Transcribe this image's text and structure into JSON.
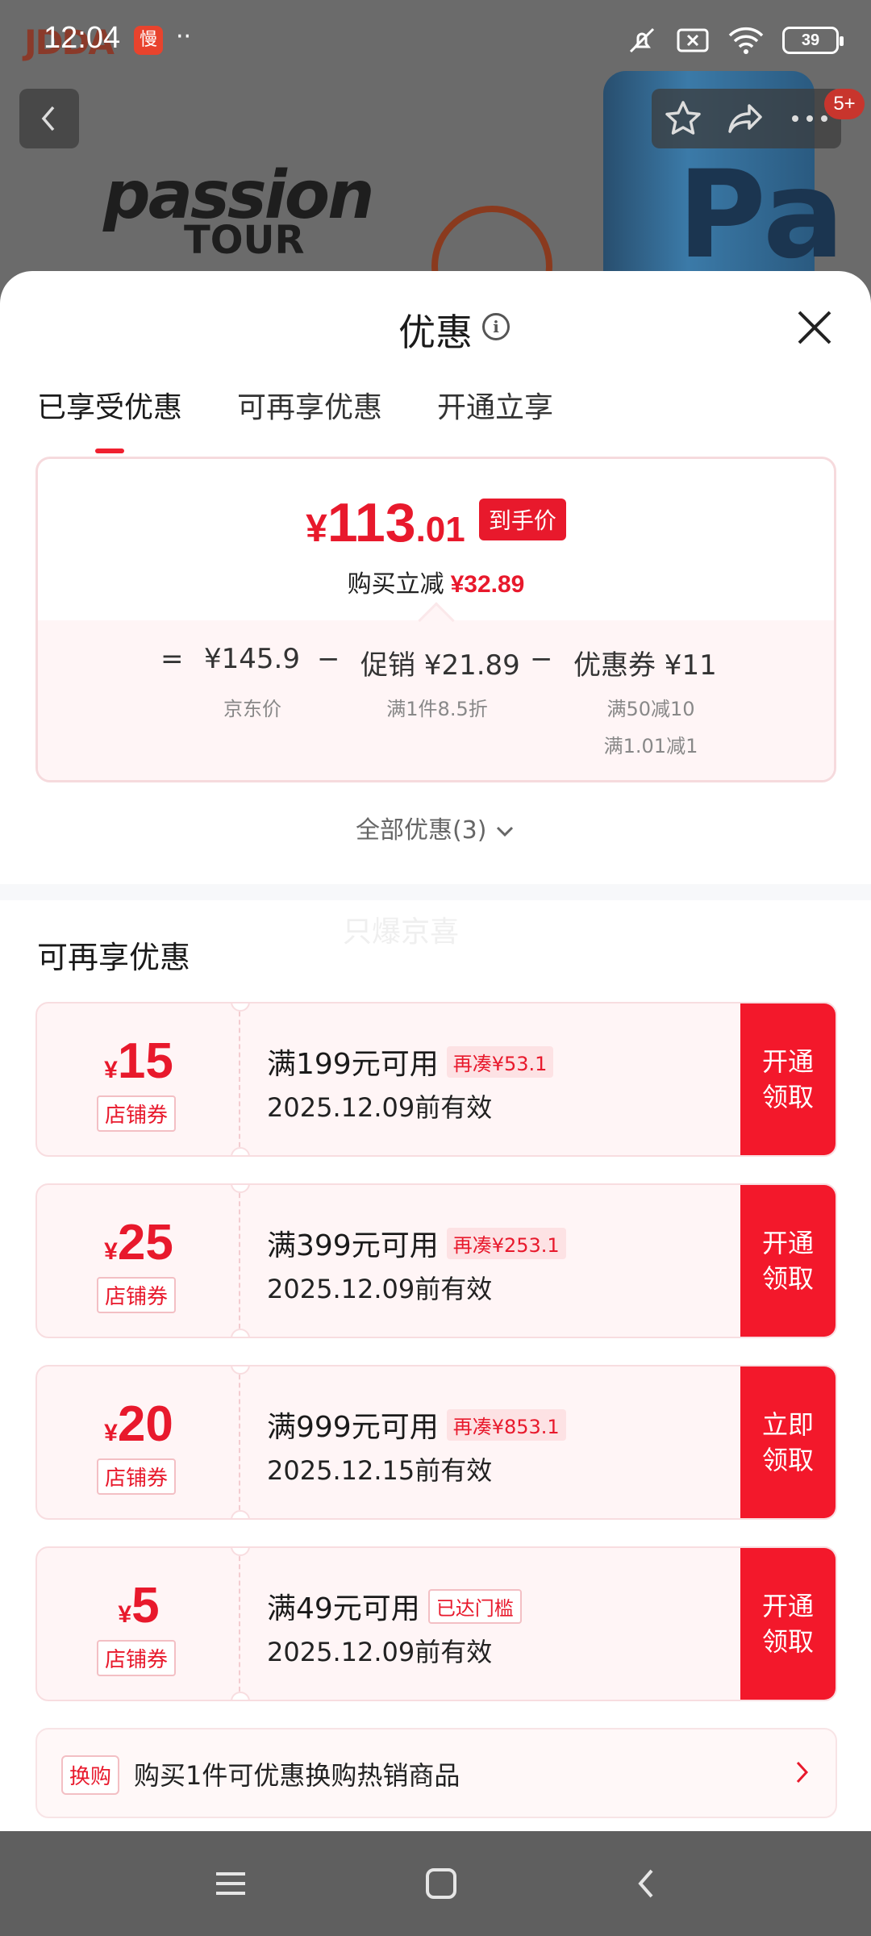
{
  "status_bar": {
    "time": "12:04",
    "app_badge": "慢",
    "dots": "··",
    "battery": "39"
  },
  "background": {
    "brand_logo": "JDDA",
    "product_line1": "passion",
    "product_line2": "TOUR",
    "can_text": "Pa",
    "message_badge": "5+"
  },
  "sheet": {
    "title": "优惠",
    "tabs": [
      {
        "label": "已享受优惠"
      },
      {
        "label": "可再享优惠"
      },
      {
        "label": "开通立享"
      }
    ],
    "summary": {
      "yen": "¥",
      "amount": "113",
      "decimal": ".01",
      "final_tag": "到手价",
      "saving_label": "购买立减",
      "saving_value": "¥32.89",
      "equals": "=",
      "base_price": "¥145.9",
      "base_label": "京东价",
      "minus1": "−",
      "promo": "促销 ¥21.89",
      "promo_label": "满1件8.5折",
      "minus2": "−",
      "coupon": "优惠券 ¥11",
      "coupon_label1": "满50减10",
      "coupon_label2": "满1.01减1"
    },
    "all_offers": "全部优惠(3)",
    "watermark": "只爆京喜",
    "section_title": "可再享优惠",
    "coupons": [
      {
        "yen": "¥",
        "value": "15",
        "type": "店铺券",
        "condition": "满199元可用",
        "extra": "再凑¥53.1",
        "date": "2025.12.09前有效",
        "action1": "开通",
        "action2": "领取"
      },
      {
        "yen": "¥",
        "value": "25",
        "type": "店铺券",
        "condition": "满399元可用",
        "extra": "再凑¥253.1",
        "date": "2025.12.09前有效",
        "action1": "开通",
        "action2": "领取"
      },
      {
        "yen": "¥",
        "value": "20",
        "type": "店铺券",
        "condition": "满999元可用",
        "extra": "再凑¥853.1",
        "date": "2025.12.15前有效",
        "action1": "立即",
        "action2": "领取"
      },
      {
        "yen": "¥",
        "value": "5",
        "type": "店铺券",
        "condition": "满49元可用",
        "extra": "已达门槛",
        "date": "2025.12.09前有效",
        "action1": "开通",
        "action2": "领取"
      }
    ],
    "swap": {
      "tag": "换购",
      "text": "购买1件可优惠换购热销商品"
    }
  },
  "colors": {
    "accent": "#e8192c",
    "action_bg": "#f3182b",
    "coupon_bg": "#fff5f6"
  },
  "icons": [
    "back-icon",
    "star-icon",
    "share-icon",
    "more-icon",
    "info-icon",
    "close-icon",
    "chevron-down-icon",
    "chevron-right-icon",
    "menu-nav-icon",
    "home-nav-icon",
    "back-nav-icon"
  ]
}
